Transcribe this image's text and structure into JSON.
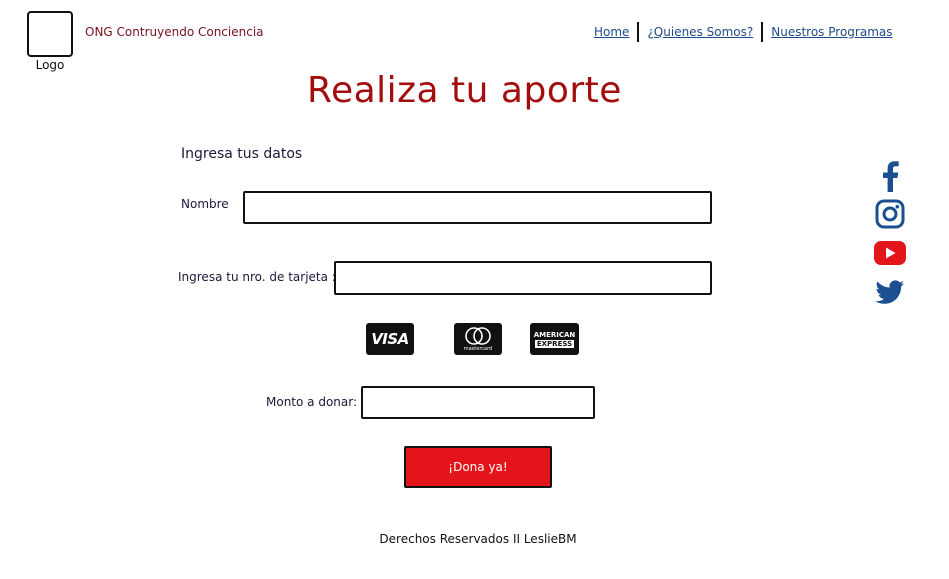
{
  "header": {
    "logo_label": "Logo",
    "org_name": "ONG Contruyendo Conciencia",
    "nav": [
      "Home",
      "¿Quienes Somos?",
      "Nuestros Programas"
    ]
  },
  "main": {
    "title": "Realiza tu aporte",
    "section_title": "Ingresa tus datos",
    "fields": {
      "nombre_label": "Nombre",
      "nombre_value": "",
      "tarjeta_label": "Ingresa tu nro. de tarjeta :",
      "tarjeta_value": "",
      "monto_label": "Monto a donar:",
      "monto_value": ""
    },
    "cards": {
      "visa": "VISA",
      "mastercard": "mastercard",
      "amex_line1": "AMERICAN",
      "amex_line2": "EXPRESS"
    },
    "donate_button": "¡Dona ya!"
  },
  "footer": {
    "text": "Derechos Reservados II LeslieBM"
  },
  "social": [
    "facebook-icon",
    "instagram-icon",
    "youtube-icon",
    "twitter-icon"
  ],
  "colors": {
    "title": "#a30d0d",
    "button": "#e3141a",
    "link": "#1e4a8a",
    "facebook": "#1b4f8f",
    "youtube": "#e3141a"
  }
}
